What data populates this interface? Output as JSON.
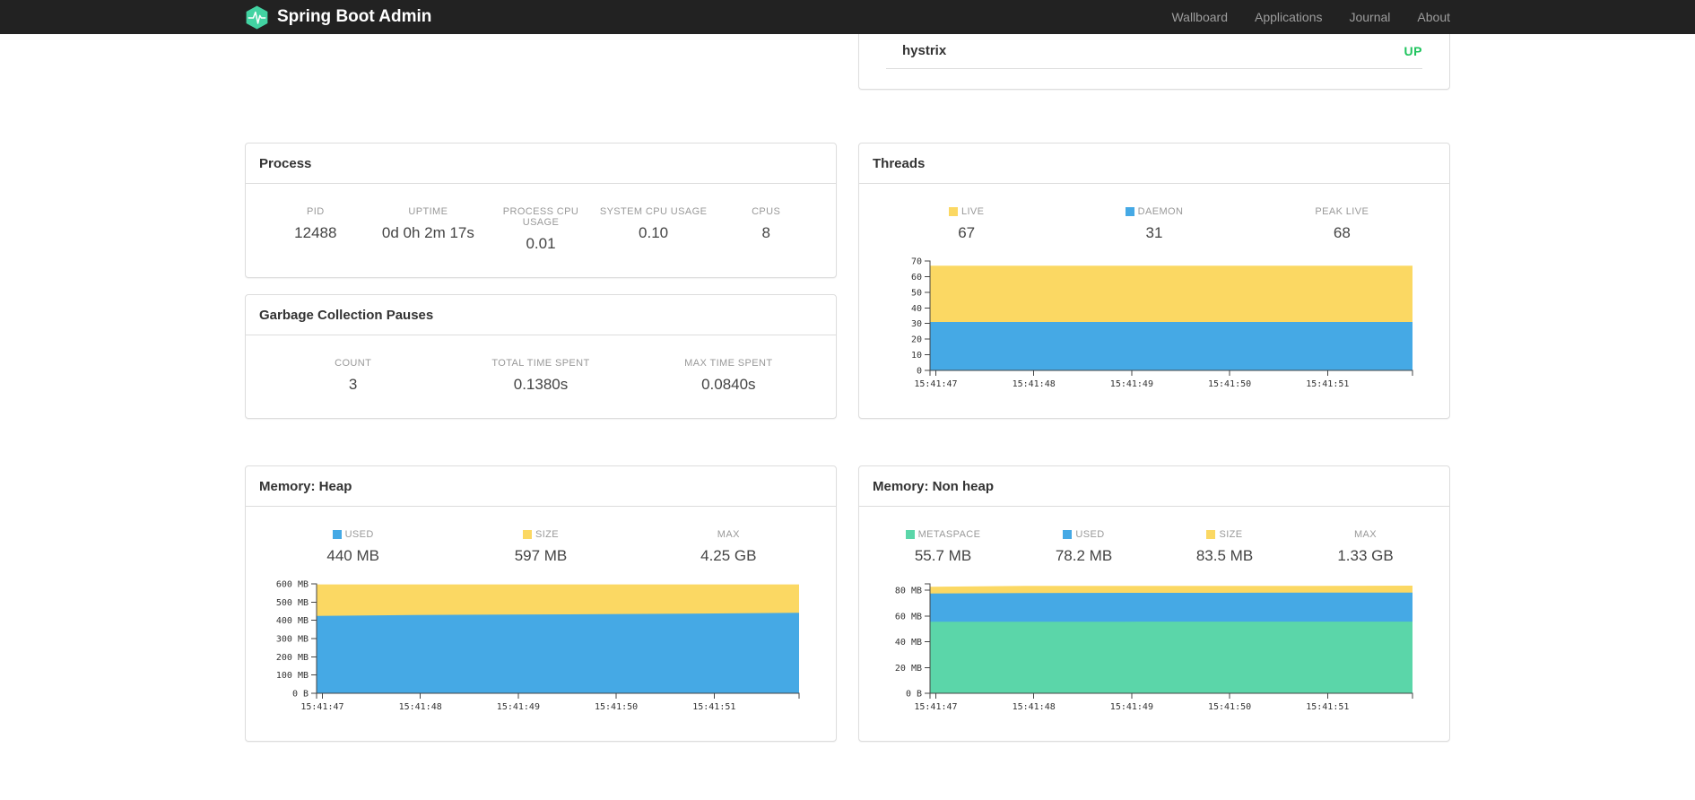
{
  "navbar": {
    "brand": "Spring Boot Admin",
    "logo_icon": "pulse-hexagon-icon",
    "links": [
      {
        "label": "Wallboard"
      },
      {
        "label": "Applications"
      },
      {
        "label": "Journal"
      },
      {
        "label": "About"
      }
    ]
  },
  "application_status_panel": {
    "application_name": "hystrix",
    "status": "UP"
  },
  "process_panel": {
    "title": "Process",
    "stats": [
      {
        "label": "PID",
        "value": "12488"
      },
      {
        "label": "UPTIME",
        "value": "0d 0h 2m 17s"
      },
      {
        "label": "PROCESS CPU USAGE",
        "value": "0.01"
      },
      {
        "label": "SYSTEM CPU USAGE",
        "value": "0.10"
      },
      {
        "label": "CPUS",
        "value": "8"
      }
    ]
  },
  "gc_panel": {
    "title": "Garbage Collection Pauses",
    "stats": [
      {
        "label": "COUNT",
        "value": "3"
      },
      {
        "label": "TOTAL TIME SPENT",
        "value": "0.1380s"
      },
      {
        "label": "MAX TIME SPENT",
        "value": "0.0840s"
      }
    ]
  },
  "threads_panel": {
    "title": "Threads",
    "stats": [
      {
        "label": "LIVE",
        "value": "67",
        "swatch": "#fbd863"
      },
      {
        "label": "DAEMON",
        "value": "31",
        "swatch": "#45a9e5"
      },
      {
        "label": "PEAK LIVE",
        "value": "68"
      }
    ]
  },
  "heap_panel": {
    "title": "Memory: Heap",
    "stats": [
      {
        "label": "USED",
        "value": "440 MB",
        "swatch": "#45a9e5"
      },
      {
        "label": "SIZE",
        "value": "597 MB",
        "swatch": "#fbd863"
      },
      {
        "label": "MAX",
        "value": "4.25 GB"
      }
    ]
  },
  "nonheap_panel": {
    "title": "Memory: Non heap",
    "stats": [
      {
        "label": "METASPACE",
        "value": "55.7 MB",
        "swatch": "#5bd6a9"
      },
      {
        "label": "USED",
        "value": "78.2 MB",
        "swatch": "#45a9e5"
      },
      {
        "label": "SIZE",
        "value": "83.5 MB",
        "swatch": "#fbd863"
      },
      {
        "label": "MAX",
        "value": "1.33 GB"
      }
    ]
  },
  "colors": {
    "navbar_bg": "#222222",
    "brand_text": "#ffffff",
    "nav_link": "#9d9d9d",
    "logo_green": "#42d3a2",
    "status_up_green": "#1fc45e",
    "panel_border": "#dddddd",
    "series_yellow": "#fbd863",
    "series_blue": "#45a9e5",
    "series_green": "#5bd6a9"
  },
  "chart_data": [
    {
      "id": "threads",
      "type": "area",
      "title": "Threads",
      "xlabel": "",
      "ylabel": "",
      "grid": false,
      "legend_position": "above",
      "x_labels": [
        "15:41:47",
        "15:41:48",
        "15:41:49",
        "15:41:50",
        "15:41:51"
      ],
      "x_tick_fractions": [
        0.012,
        0.215,
        0.418,
        0.621,
        0.824
      ],
      "y_domain": [
        0,
        70
      ],
      "y_ticks": [
        {
          "value": 0,
          "label": "0"
        },
        {
          "value": 10,
          "label": "10"
        },
        {
          "value": 20,
          "label": "20"
        },
        {
          "value": 30,
          "label": "30"
        },
        {
          "value": 40,
          "label": "40"
        },
        {
          "value": 50,
          "label": "50"
        },
        {
          "value": 60,
          "label": "60"
        },
        {
          "value": 70,
          "label": "70"
        }
      ],
      "series": [
        {
          "name": "LIVE",
          "color": "#fbd863",
          "values": [
            67,
            67,
            67,
            67,
            67,
            67
          ]
        },
        {
          "name": "DAEMON",
          "color": "#45a9e5",
          "values": [
            31,
            31,
            31,
            31,
            31,
            31
          ]
        }
      ]
    },
    {
      "id": "heap",
      "type": "area",
      "title": "Memory: Heap",
      "xlabel": "",
      "ylabel": "",
      "grid": false,
      "legend_position": "above",
      "x_labels": [
        "15:41:47",
        "15:41:48",
        "15:41:49",
        "15:41:50",
        "15:41:51"
      ],
      "x_tick_fractions": [
        0.012,
        0.215,
        0.418,
        0.621,
        0.824
      ],
      "y_domain": [
        0,
        600
      ],
      "y_ticks": [
        {
          "value": 0,
          "label": "0 B"
        },
        {
          "value": 100,
          "label": "100 MB"
        },
        {
          "value": 200,
          "label": "200 MB"
        },
        {
          "value": 300,
          "label": "300 MB"
        },
        {
          "value": 400,
          "label": "400 MB"
        },
        {
          "value": 500,
          "label": "500 MB"
        },
        {
          "value": 600,
          "label": "600 MB"
        }
      ],
      "series": [
        {
          "name": "SIZE",
          "color": "#fbd863",
          "values": [
            597,
            597,
            597,
            597,
            597,
            597
          ]
        },
        {
          "name": "USED",
          "color": "#45a9e5",
          "values": [
            424,
            429,
            432,
            434,
            437,
            441
          ]
        }
      ]
    },
    {
      "id": "nonheap",
      "type": "area",
      "title": "Memory: Non heap",
      "xlabel": "",
      "ylabel": "",
      "grid": false,
      "legend_position": "above",
      "x_labels": [
        "15:41:47",
        "15:41:48",
        "15:41:49",
        "15:41:50",
        "15:41:51"
      ],
      "x_tick_fractions": [
        0.012,
        0.215,
        0.418,
        0.621,
        0.824
      ],
      "y_domain": [
        0,
        85
      ],
      "y_ticks": [
        {
          "value": 0,
          "label": "0 B"
        },
        {
          "value": 20,
          "label": "20 MB"
        },
        {
          "value": 40,
          "label": "40 MB"
        },
        {
          "value": 60,
          "label": "60 MB"
        },
        {
          "value": 80,
          "label": "80 MB"
        }
      ],
      "series": [
        {
          "name": "SIZE",
          "color": "#fbd863",
          "values": [
            82.7,
            83.5,
            83.5,
            83.5,
            83.5,
            83.6
          ]
        },
        {
          "name": "USED",
          "color": "#45a9e5",
          "values": [
            77.5,
            77.9,
            78.0,
            78.0,
            78.2,
            78.2
          ]
        },
        {
          "name": "METASPACE",
          "color": "#5bd6a9",
          "values": [
            55.5,
            55.6,
            55.6,
            55.7,
            55.7,
            55.7
          ]
        }
      ]
    }
  ]
}
